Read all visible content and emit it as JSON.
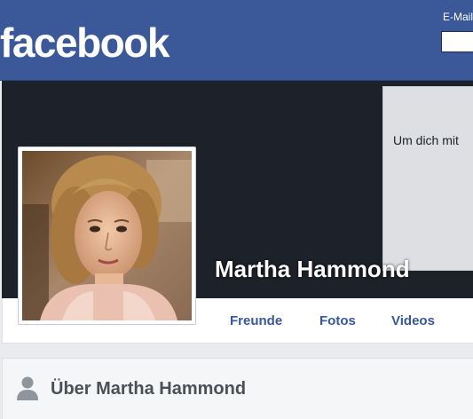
{
  "header": {
    "logo_text": "facebook",
    "email_label": "E-Mail",
    "email_value": "",
    "brand_color": "#3b5998"
  },
  "profile": {
    "name": "Martha Hammond",
    "signup_prompt": "Um dich mit",
    "photo_icon": "profile-photo"
  },
  "tabs": [
    {
      "label": "Freunde"
    },
    {
      "label": "Fotos"
    },
    {
      "label": "Videos"
    }
  ],
  "about": {
    "title": "Über Martha Hammond",
    "icon": "person-icon"
  }
}
